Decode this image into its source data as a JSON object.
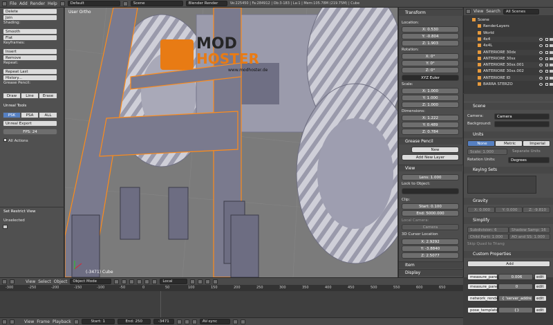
{
  "topbar": {
    "menus": [
      "File",
      "Add",
      "Render",
      "Help"
    ],
    "layout": "Default",
    "scene": "Scene",
    "engine": "Blender Render",
    "stats": "Ve:225450 | Fa:284912 | Ob:3-183 | La:1 | Mem:105.78M (219.75M) | Cube"
  },
  "toolshelf": {
    "items": [
      {
        "t": "btn",
        "label": "Delete"
      },
      {
        "t": "btn",
        "label": "Join"
      },
      {
        "t": "lbl",
        "label": "Shading:"
      },
      {
        "t": "btn",
        "label": "Smooth"
      },
      {
        "t": "btn",
        "label": "Flat"
      },
      {
        "t": "lbl",
        "label": "Keyframes:"
      },
      {
        "t": "btn",
        "label": "Insert"
      },
      {
        "t": "btn",
        "label": "Remove"
      },
      {
        "t": "lbl",
        "label": "Repeat:"
      },
      {
        "t": "btn",
        "label": "Repeat Last"
      },
      {
        "t": "btn",
        "label": "History..."
      },
      {
        "t": "lbl",
        "label": "Grease Pencil:"
      }
    ],
    "grease": [
      "Draw",
      "Line",
      "Erase"
    ],
    "unreal_header": "Unreal Tools",
    "format_tabs": [
      "PSK",
      "PSA",
      "ALL"
    ],
    "unreal_export": "Unreal Export",
    "fps": "FPS: 24",
    "all_actions": "All Actions",
    "restrict_header": "Set Restrict View",
    "unselected": "Unselected"
  },
  "viewport": {
    "label": "User Ortho",
    "object_info": "(-3471) Cube",
    "watermark": {
      "line1": "MOD",
      "line2": "HOSTER",
      "url": "www.modhoster.de"
    }
  },
  "npanel": {
    "transform": "Transform",
    "location_label": "Location:",
    "location": [
      "X: 0.530",
      "Y: -0.804",
      "Z: 1.903"
    ],
    "rotation_label": "Rotation:",
    "rotation": [
      "X: 0°",
      "Y: 0°",
      "Z: 0°"
    ],
    "rot_mode": "XYZ Euler",
    "scale_label": "Scale:",
    "scale": [
      "X: 1.000",
      "Y: 1.000",
      "Z: 1.000"
    ],
    "dimensions_label": "Dimensions:",
    "dimensions": [
      "X: 1.222",
      "Y: 0.489",
      "Z: 0.784"
    ],
    "grease_header": "Grease Pencil",
    "new": "New",
    "add_layer": "Add New Layer",
    "view_header": "View",
    "lens": "Lens: 1.000",
    "lock_label": "Lock to Object:",
    "clip_label": "Clip:",
    "clip_start": "Start: 0.100",
    "clip_end": "End: 5000.000",
    "local_camera": "Local Camera:",
    "camera_field": "Camera",
    "cursor_label": "3D Cursor Location",
    "cursor": [
      "X: 2.9292",
      "Y: -3.8840",
      "Z: 2.5077"
    ],
    "item_header": "Item",
    "display_header": "Display"
  },
  "outliner": {
    "menus": [
      "View",
      "Search"
    ],
    "filter": "All Scenes",
    "rows": [
      {
        "label": "Scene",
        "indent": 1
      },
      {
        "label": "RenderLayers",
        "indent": 2
      },
      {
        "label": "World",
        "indent": 2
      },
      {
        "label": "4x4",
        "indent": 2
      },
      {
        "label": "4x4L",
        "indent": 2
      },
      {
        "label": "ANTERIORE 30dx",
        "indent": 2
      },
      {
        "label": "ANTERIORE 30sx",
        "indent": 2
      },
      {
        "label": "ANTERIORE 30sx.001",
        "indent": 2
      },
      {
        "label": "ANTERIORE 30sx.002",
        "indent": 2
      },
      {
        "label": "ANTERIORE ID",
        "indent": 2
      },
      {
        "label": "BARRA STERZO",
        "indent": 2
      }
    ]
  },
  "properties": {
    "scene_header": "Scene",
    "camera_label": "Camera:",
    "camera_value": "Camera",
    "background_label": "Background:",
    "units_header": "Units",
    "unit_tabs": [
      "None",
      "Metric",
      "Imperial"
    ],
    "scale": "Scale: 1.000",
    "separate_units": "Separate Units",
    "rotation_units_label": "Rotation Units:",
    "rotation_units": "Degrees",
    "keying_header": "Keying Sets",
    "gravity_header": "Gravity",
    "gravity": [
      "X: 0.000",
      "Y: 0.000",
      "Z: -9.810"
    ],
    "simplify_header": "Simplify",
    "subdivision": "Subdivision: 6",
    "shadow_samples": "Shadow Samp: 16",
    "child_particles": "Child Parti: 1.000",
    "ao_sss": "AO and SS: 1.000",
    "skip_quad": "Skip Quad to Triang",
    "custom_header": "Custom Properties",
    "add": "Add",
    "custom": [
      {
        "name": "measure_panel",
        "value": "0.006"
      },
      {
        "name": "measure_panel",
        "value": "0"
      },
      {
        "name": "network_rende",
        "value": "{ 'server_addre"
      },
      {
        "name": "pose_template",
        "value": "{}"
      }
    ],
    "edit": "edit"
  },
  "viewport_header": {
    "menus": [
      "View",
      "Select",
      "Object"
    ],
    "mode": "Object Mode",
    "pivot": "Local"
  },
  "timeline": {
    "ruler": [
      "-300",
      "-250",
      "-200",
      "-150",
      "-100",
      "-50",
      "0",
      "50",
      "100",
      "150",
      "200",
      "250",
      "300",
      "350",
      "400",
      "450",
      "500",
      "550",
      "600",
      "650"
    ]
  },
  "timeline_header": {
    "menus": [
      "View",
      "Frame",
      "Playback"
    ],
    "start": "Start: 1",
    "end": "End: 250",
    "current": "-3471",
    "sync": "AV-sync"
  },
  "colors": {
    "selection": "#ff8c1a",
    "accent": "#5680c2",
    "bg": "#7a7a7a"
  }
}
